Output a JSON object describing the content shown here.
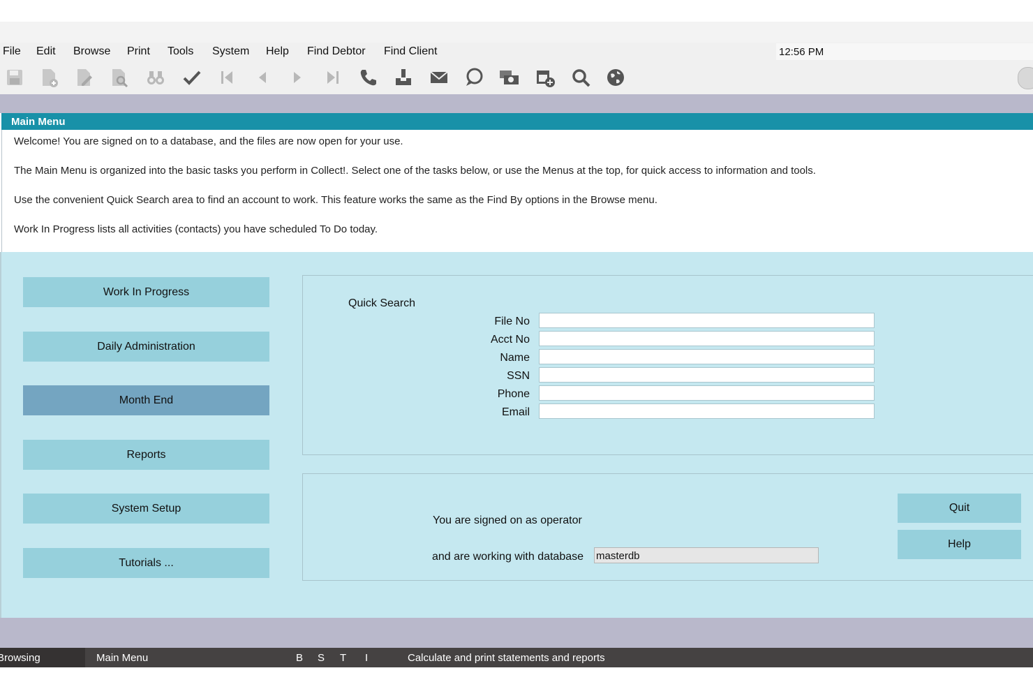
{
  "menubar": {
    "items": [
      "File",
      "Edit",
      "Browse",
      "Print",
      "Tools",
      "System",
      "Help",
      "Find Debtor",
      "Find Client"
    ],
    "clock": "12:56 PM"
  },
  "toolbar": {
    "icons": [
      "save-icon",
      "new-document-icon",
      "edit-document-icon",
      "preview-icon",
      "binoculars-icon",
      "check-icon",
      "first-record-icon",
      "previous-icon",
      "next-icon",
      "last-record-icon",
      "phone-icon",
      "inbox-icon",
      "mail-icon",
      "chat-icon",
      "payment-card-icon",
      "calendar-add-icon",
      "search-icon",
      "globe-icon"
    ]
  },
  "main_menu": {
    "header": "Main Menu",
    "intro": [
      "Welcome! You are signed on to a database, and the files are now open for your use.",
      "The Main Menu is organized into the basic tasks you perform in Collect!. Select one of the tasks below, or use the Menus at the top, for quick access to information and tools.",
      "Use the convenient Quick Search area to find an account to work. This feature works the same as the Find By options in the Browse menu.",
      "Work In Progress lists all activities (contacts) you have scheduled To Do today."
    ]
  },
  "nav": {
    "work_in_progress": "Work In Progress",
    "daily_administration": "Daily Administration",
    "month_end": "Month End",
    "reports": "Reports",
    "system_setup": "System Setup",
    "tutorials": "Tutorials ..."
  },
  "quick_search": {
    "title": "Quick Search",
    "fields": [
      "File No",
      "Acct No",
      "Name",
      "SSN",
      "Phone",
      "Email"
    ],
    "values": [
      "",
      "",
      "",
      "",
      "",
      ""
    ]
  },
  "operator": {
    "signed_on_text": "You are signed on as operator",
    "database_text": "and are working with database",
    "database_value": "masterdb"
  },
  "buttons": {
    "quit": "Quit",
    "help": "Help"
  },
  "statusbar": {
    "mode": "Browsing",
    "screen": "Main Menu",
    "b": "B",
    "s": "S",
    "t": "T",
    "i": "I",
    "hint": "Calculate and print statements and reports"
  },
  "colors": {
    "header": "#1891a8",
    "panel_bg": "#c5e8f0",
    "button": "#96d0dc",
    "button_active": "#74a5c1",
    "statusbar": "#454242"
  }
}
